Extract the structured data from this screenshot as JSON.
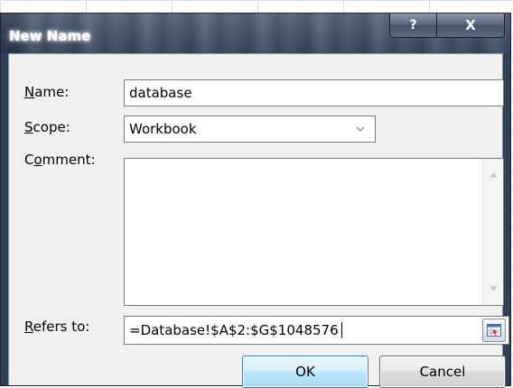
{
  "dialog": {
    "title": "New Name",
    "help_label": "?",
    "close_label": "X"
  },
  "form": {
    "name_label_accel": "N",
    "name_label_rest": "ame:",
    "name_value": "database",
    "scope_label_accel": "S",
    "scope_label_rest": "cope:",
    "scope_value": "Workbook",
    "comment_label_pre": "C",
    "comment_label_accel": "o",
    "comment_label_rest": "mment:",
    "comment_value": "",
    "refers_label_accel": "R",
    "refers_label_rest": "efers to:",
    "refers_value": "=Database!$A$2:$G$1048576"
  },
  "buttons": {
    "ok_label": "OK",
    "cancel_label": "Cancel"
  },
  "icons": {
    "scroll_up": "scroll-up-icon",
    "scroll_down": "scroll-down-icon",
    "dropdown": "chevron-down-icon",
    "collapse": "collapse-dialog-icon"
  },
  "colors": {
    "titlebar": "#3f4f68",
    "ok_border": "#3c7fb1",
    "dialog_face": "#f0f0f0"
  }
}
